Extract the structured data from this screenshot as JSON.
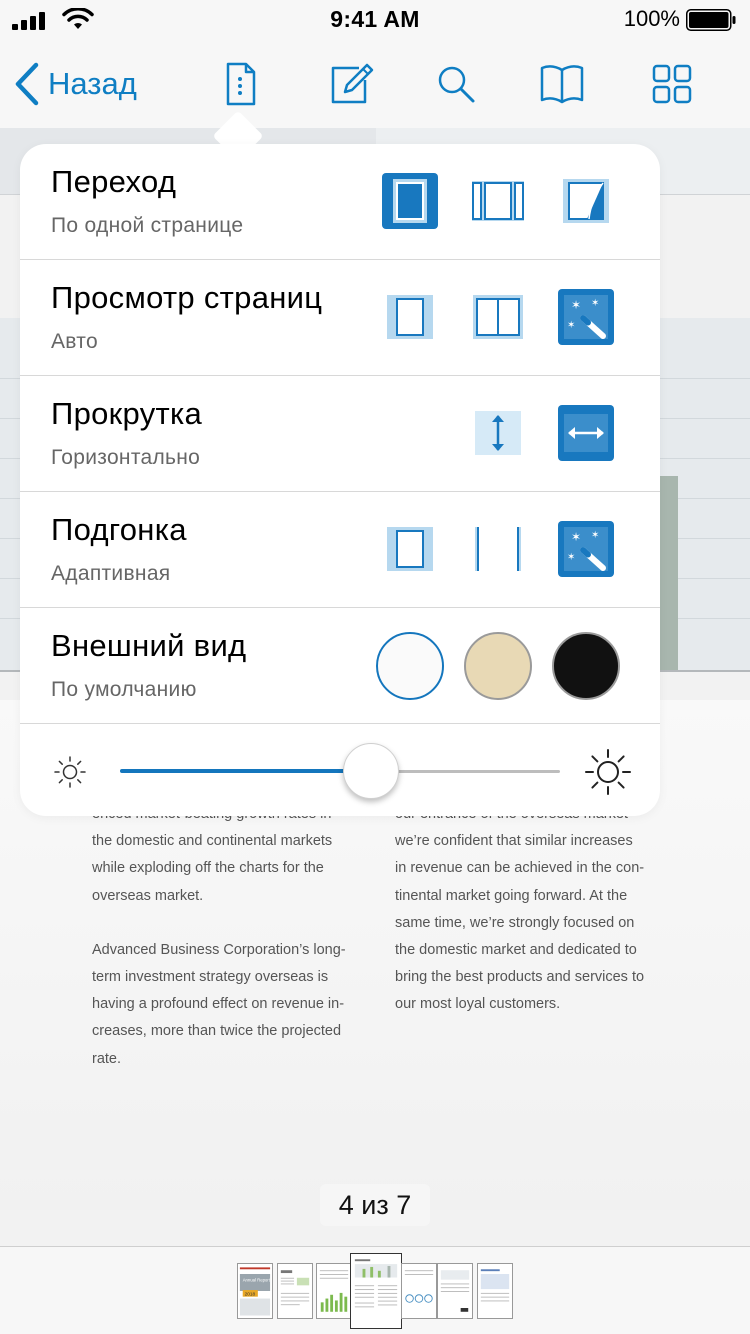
{
  "status_bar": {
    "time": "9:41 AM",
    "battery_text": "100%",
    "battery_level": 1.0
  },
  "nav": {
    "back_label": "Назад",
    "icons": [
      "document-settings-icon",
      "annotate-icon",
      "search-icon",
      "bookmarks-icon",
      "grid-icon"
    ]
  },
  "colors": {
    "accent": "#0f7ec3",
    "selected_fill": "#1878bf",
    "option_light": "#b6d8ef",
    "text_secondary": "#666666",
    "appearance_white": "#fafafa",
    "appearance_sepia": "#e8d9b5",
    "appearance_black": "#111111"
  },
  "popover": {
    "transition": {
      "title": "Переход",
      "value": "По одной странице",
      "options": [
        "single-page-icon",
        "continuous-pages-icon",
        "page-curl-icon"
      ],
      "selected": 0
    },
    "page_view": {
      "title": "Просмотр страниц",
      "value": "Авто",
      "options": [
        "single-page-view-icon",
        "double-page-view-icon",
        "auto-magic-icon"
      ],
      "selected": 2
    },
    "scroll": {
      "title": "Прокрутка",
      "value": "Горизонтально",
      "options": [
        "vertical-scroll-icon",
        "horizontal-scroll-icon"
      ],
      "selected": 1
    },
    "fit": {
      "title": "Подгонка",
      "value": "Адаптивная",
      "options": [
        "fit-page-icon",
        "fit-width-icon",
        "fit-adaptive-magic-icon"
      ],
      "selected": 2
    },
    "appearance": {
      "title": "Внешний вид",
      "value": "По умолчанию",
      "options": [
        "white",
        "sepia",
        "black"
      ],
      "selected": 0
    },
    "brightness": {
      "value": 0.57
    }
  },
  "document": {
    "left_column": [
      "enced market-beating growth rates in\nthe domestic and continental markets\nwhile exploding off the charts for the\noverseas market.",
      "Advanced Business Corporation’s long-\nterm investment strategy overseas is\nhaving a profound effect on revenue in-\ncreases, more than twice the projected\nrate."
    ],
    "right_column": [
      "our entrance of the overseas market\nwe’re confident that similar increases\nin revenue can be achieved in the con-\ntinental market going forward. At the\nsame time, we’re strongly focused on\nthe domestic market and dedicated to\nbring the best products and services to\nour most loyal customers."
    ]
  },
  "page_counter": "4 из 7",
  "thumbnails": {
    "count": 7,
    "current_index": 3,
    "cover_title": "Annual Report",
    "cover_year": "2018"
  }
}
